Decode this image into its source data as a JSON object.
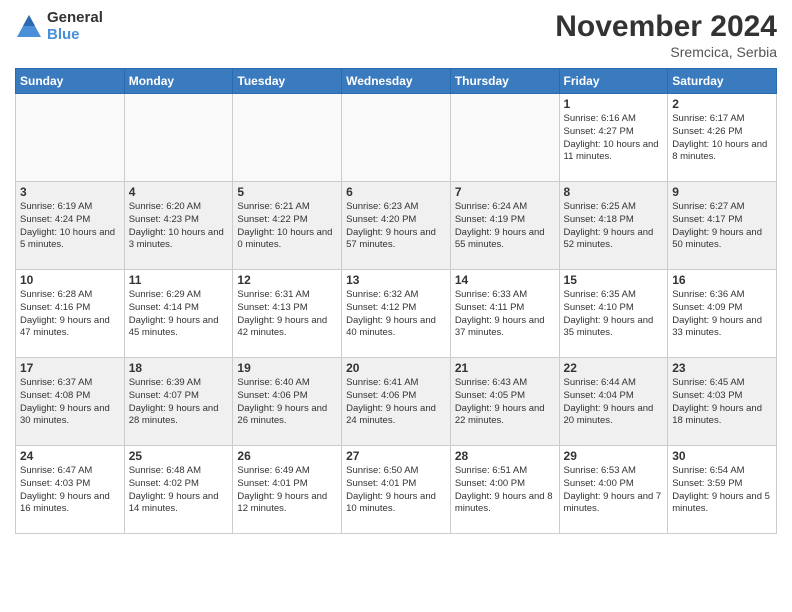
{
  "header": {
    "logo_general": "General",
    "logo_blue": "Blue",
    "month_title": "November 2024",
    "location": "Sremcica, Serbia"
  },
  "weekdays": [
    "Sunday",
    "Monday",
    "Tuesday",
    "Wednesday",
    "Thursday",
    "Friday",
    "Saturday"
  ],
  "weeks": [
    [
      {
        "day": "",
        "info": ""
      },
      {
        "day": "",
        "info": ""
      },
      {
        "day": "",
        "info": ""
      },
      {
        "day": "",
        "info": ""
      },
      {
        "day": "",
        "info": ""
      },
      {
        "day": "1",
        "info": "Sunrise: 6:16 AM\nSunset: 4:27 PM\nDaylight: 10 hours\nand 11 minutes."
      },
      {
        "day": "2",
        "info": "Sunrise: 6:17 AM\nSunset: 4:26 PM\nDaylight: 10 hours\nand 8 minutes."
      }
    ],
    [
      {
        "day": "3",
        "info": "Sunrise: 6:19 AM\nSunset: 4:24 PM\nDaylight: 10 hours\nand 5 minutes."
      },
      {
        "day": "4",
        "info": "Sunrise: 6:20 AM\nSunset: 4:23 PM\nDaylight: 10 hours\nand 3 minutes."
      },
      {
        "day": "5",
        "info": "Sunrise: 6:21 AM\nSunset: 4:22 PM\nDaylight: 10 hours\nand 0 minutes."
      },
      {
        "day": "6",
        "info": "Sunrise: 6:23 AM\nSunset: 4:20 PM\nDaylight: 9 hours\nand 57 minutes."
      },
      {
        "day": "7",
        "info": "Sunrise: 6:24 AM\nSunset: 4:19 PM\nDaylight: 9 hours\nand 55 minutes."
      },
      {
        "day": "8",
        "info": "Sunrise: 6:25 AM\nSunset: 4:18 PM\nDaylight: 9 hours\nand 52 minutes."
      },
      {
        "day": "9",
        "info": "Sunrise: 6:27 AM\nSunset: 4:17 PM\nDaylight: 9 hours\nand 50 minutes."
      }
    ],
    [
      {
        "day": "10",
        "info": "Sunrise: 6:28 AM\nSunset: 4:16 PM\nDaylight: 9 hours\nand 47 minutes."
      },
      {
        "day": "11",
        "info": "Sunrise: 6:29 AM\nSunset: 4:14 PM\nDaylight: 9 hours\nand 45 minutes."
      },
      {
        "day": "12",
        "info": "Sunrise: 6:31 AM\nSunset: 4:13 PM\nDaylight: 9 hours\nand 42 minutes."
      },
      {
        "day": "13",
        "info": "Sunrise: 6:32 AM\nSunset: 4:12 PM\nDaylight: 9 hours\nand 40 minutes."
      },
      {
        "day": "14",
        "info": "Sunrise: 6:33 AM\nSunset: 4:11 PM\nDaylight: 9 hours\nand 37 minutes."
      },
      {
        "day": "15",
        "info": "Sunrise: 6:35 AM\nSunset: 4:10 PM\nDaylight: 9 hours\nand 35 minutes."
      },
      {
        "day": "16",
        "info": "Sunrise: 6:36 AM\nSunset: 4:09 PM\nDaylight: 9 hours\nand 33 minutes."
      }
    ],
    [
      {
        "day": "17",
        "info": "Sunrise: 6:37 AM\nSunset: 4:08 PM\nDaylight: 9 hours\nand 30 minutes."
      },
      {
        "day": "18",
        "info": "Sunrise: 6:39 AM\nSunset: 4:07 PM\nDaylight: 9 hours\nand 28 minutes."
      },
      {
        "day": "19",
        "info": "Sunrise: 6:40 AM\nSunset: 4:06 PM\nDaylight: 9 hours\nand 26 minutes."
      },
      {
        "day": "20",
        "info": "Sunrise: 6:41 AM\nSunset: 4:06 PM\nDaylight: 9 hours\nand 24 minutes."
      },
      {
        "day": "21",
        "info": "Sunrise: 6:43 AM\nSunset: 4:05 PM\nDaylight: 9 hours\nand 22 minutes."
      },
      {
        "day": "22",
        "info": "Sunrise: 6:44 AM\nSunset: 4:04 PM\nDaylight: 9 hours\nand 20 minutes."
      },
      {
        "day": "23",
        "info": "Sunrise: 6:45 AM\nSunset: 4:03 PM\nDaylight: 9 hours\nand 18 minutes."
      }
    ],
    [
      {
        "day": "24",
        "info": "Sunrise: 6:47 AM\nSunset: 4:03 PM\nDaylight: 9 hours\nand 16 minutes."
      },
      {
        "day": "25",
        "info": "Sunrise: 6:48 AM\nSunset: 4:02 PM\nDaylight: 9 hours\nand 14 minutes."
      },
      {
        "day": "26",
        "info": "Sunrise: 6:49 AM\nSunset: 4:01 PM\nDaylight: 9 hours\nand 12 minutes."
      },
      {
        "day": "27",
        "info": "Sunrise: 6:50 AM\nSunset: 4:01 PM\nDaylight: 9 hours\nand 10 minutes."
      },
      {
        "day": "28",
        "info": "Sunrise: 6:51 AM\nSunset: 4:00 PM\nDaylight: 9 hours\nand 8 minutes."
      },
      {
        "day": "29",
        "info": "Sunrise: 6:53 AM\nSunset: 4:00 PM\nDaylight: 9 hours\nand 7 minutes."
      },
      {
        "day": "30",
        "info": "Sunrise: 6:54 AM\nSunset: 3:59 PM\nDaylight: 9 hours\nand 5 minutes."
      }
    ]
  ]
}
